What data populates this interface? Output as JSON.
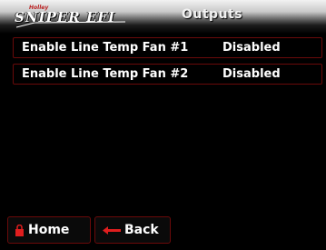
{
  "header": {
    "logo_text": "SNIPER EFI",
    "logo_small": "Holley",
    "title": "Outputs"
  },
  "rows": [
    {
      "label": "Enable Line Temp Fan #1",
      "value": "Disabled"
    },
    {
      "label": "Enable Line Temp Fan #2",
      "value": "Disabled"
    }
  ],
  "footer": {
    "home_label": "Home",
    "home_icon": "lock-icon",
    "back_label": "Back",
    "back_icon": "left-arrow-icon"
  },
  "colors": {
    "accent": "#e01e1e",
    "border": "#6a0a0a",
    "background": "#000000"
  }
}
